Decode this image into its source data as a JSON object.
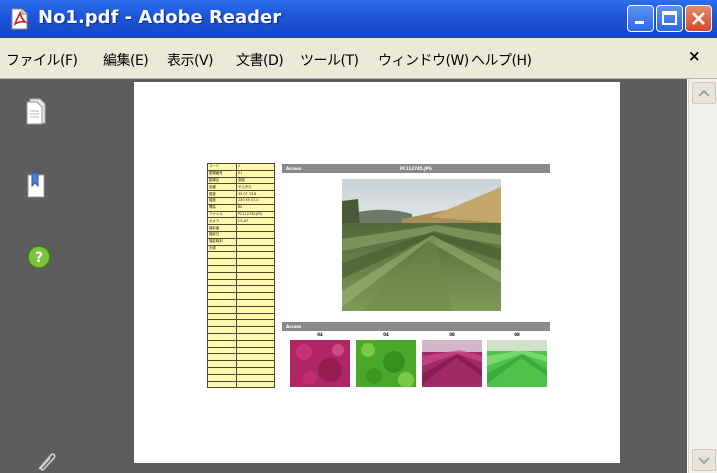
{
  "window": {
    "title": "No1.pdf - Adobe Reader",
    "icon": "pdf-file-icon"
  },
  "menubar": {
    "items": [
      "ファイル(F)",
      "編集(E)",
      "表示(V)",
      "文書(D)",
      "ツール(T)",
      "ウィンドウ(W)",
      "ヘルプ(H)"
    ],
    "close_label": "×"
  },
  "navpane": {
    "icons": [
      "pages-icon",
      "bookmarks-icon",
      "help-icon",
      "attachments-icon"
    ]
  },
  "document": {
    "info_table": {
      "rows": [
        [
          "コード",
          "1"
        ],
        [
          "圃場番号",
          "01"
        ],
        [
          "圃場名",
          "茶園"
        ],
        [
          "品種",
          "やぶきた"
        ],
        [
          "緯度",
          "33 07 33.6"
        ],
        [
          "経度",
          "130 55 07.0"
        ],
        [
          "標高",
          "60"
        ],
        [
          "ファイル",
          "PC112745.JPG"
        ],
        [
          "カメラ",
          "C5-07"
        ],
        [
          "撮影者",
          ""
        ],
        [
          "撮影日",
          ""
        ],
        [
          "撮影時刻",
          ""
        ],
        [
          "天候",
          ""
        ],
        [
          "",
          ""
        ],
        [
          "",
          ""
        ],
        [
          "",
          ""
        ],
        [
          "",
          ""
        ],
        [
          "",
          ""
        ],
        [
          "",
          ""
        ],
        [
          "",
          ""
        ],
        [
          "",
          ""
        ],
        [
          "",
          ""
        ],
        [
          "",
          ""
        ],
        [
          "",
          ""
        ],
        [
          "",
          ""
        ],
        [
          "",
          ""
        ],
        [
          "",
          ""
        ],
        [
          "",
          ""
        ],
        [
          "",
          ""
        ],
        [
          "",
          ""
        ],
        [
          "",
          ""
        ],
        [
          "",
          ""
        ],
        [
          "",
          ""
        ]
      ]
    },
    "photo_bar": {
      "left_label": "Access",
      "right_label": "PC112745.JPG"
    },
    "thumb_bar": {
      "left_label": "Access"
    },
    "thumb_labels": [
      "04",
      "04",
      "08",
      "08"
    ]
  },
  "colors": {
    "titlebar": "#1b55d6",
    "menubar": "#ece9d8",
    "pane": "#5d5d5d",
    "table_fill": "#fff9b0",
    "section_bar": "#8a8a8a"
  }
}
